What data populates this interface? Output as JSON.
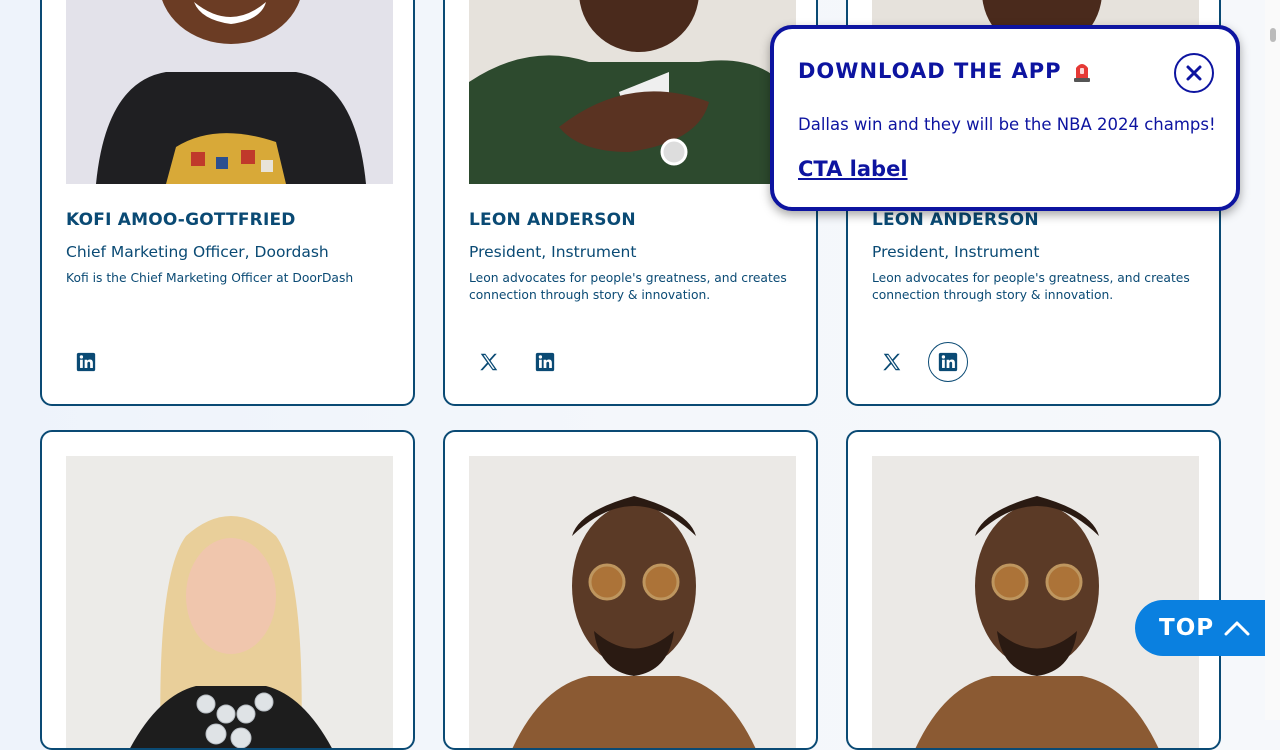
{
  "cards": [
    {
      "name": "KOFI AMOO-GOTTFRIED",
      "role": "Chief Marketing Officer, Doordash",
      "bio": "Kofi is the Chief Marketing Officer at DoorDash",
      "socials": [
        "linkedin-icon"
      ]
    },
    {
      "name": "LEON ANDERSON",
      "role": "President, Instrument",
      "bio": "Leon advocates for people's greatness, and creates connection through story & innovation.",
      "socials": [
        "x-icon",
        "linkedin-icon"
      ]
    },
    {
      "name": "LEON ANDERSON",
      "role": "President, Instrument",
      "bio": "Leon advocates for people's greatness, and creates connection through story & innovation.",
      "socials": [
        "x-icon",
        "linkedin-icon"
      ]
    }
  ],
  "popup": {
    "title": "DOWNLOAD THE APP",
    "title_icon": "siren-emoji-icon",
    "text": "Dallas win and they will be the NBA 2024 champs!",
    "cta": "CTA label",
    "close_icon": "close-icon"
  },
  "top_button": {
    "label": "TOP",
    "icon": "chevron-up-icon"
  },
  "colors": {
    "navy": "#0a4a74",
    "popup_blue": "#0d14a0",
    "top_button": "#0a80e0"
  }
}
